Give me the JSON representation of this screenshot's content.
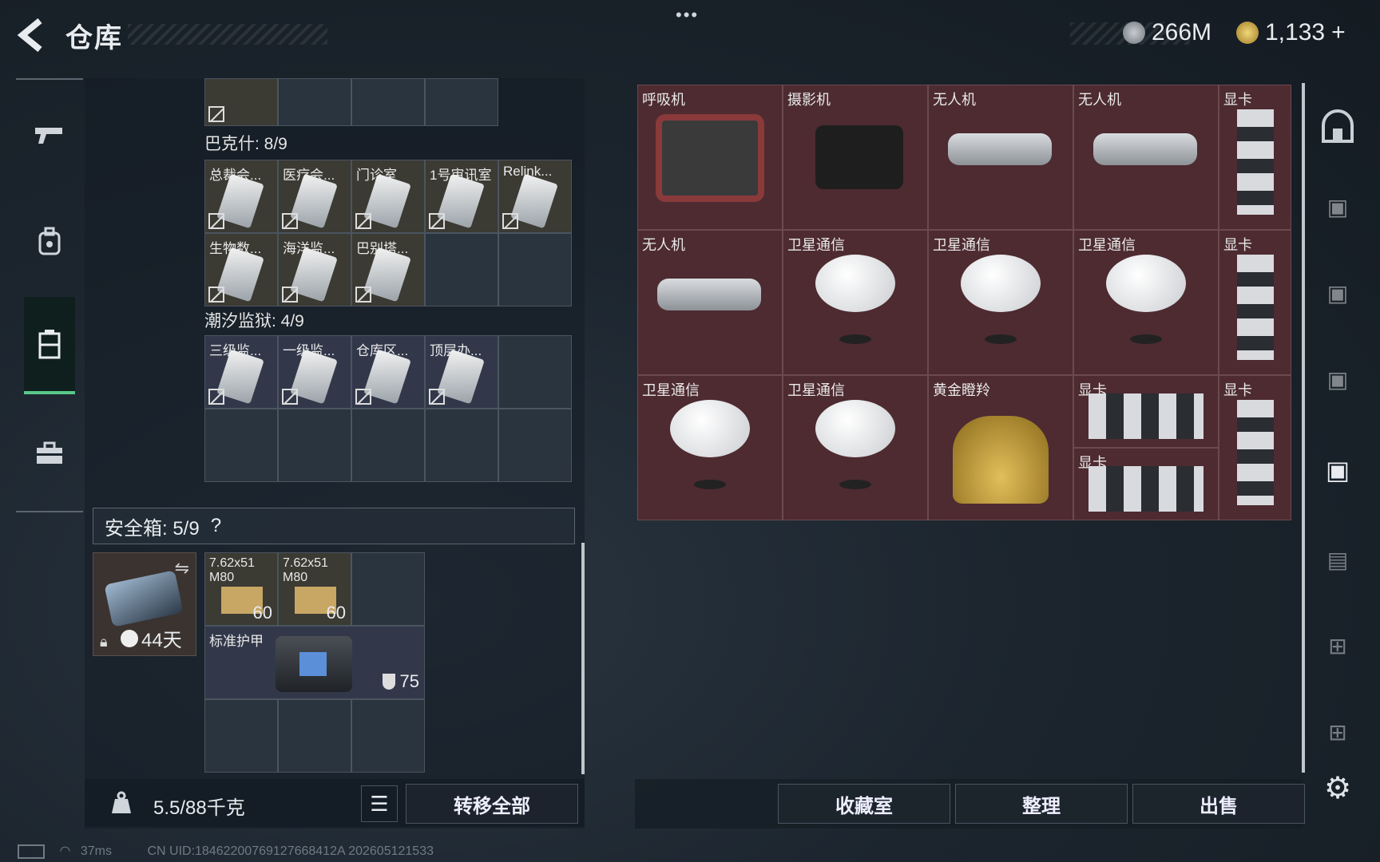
{
  "header": {
    "title": "仓库",
    "dots": "•••",
    "currency_silver": "266M",
    "currency_gold": "1,133",
    "plus": "+"
  },
  "left_nav": [
    "weapon-icon",
    "backpack-icon",
    "storage-icon",
    "toolbox-icon"
  ],
  "keys": {
    "bakshi_title": "巴克什: 8/9",
    "bakshi_items": [
      "总裁会...",
      "医疗会...",
      "门诊室",
      "1号审讯室",
      "Relink...",
      "生物数...",
      "海洋监...",
      "巴别塔..."
    ],
    "tide_title": "潮汐监狱: 4/9",
    "tide_items": [
      "三级监...",
      "一级监...",
      "仓库区...",
      "顶层办..."
    ]
  },
  "safe_box": {
    "title": "安全箱: 5/9",
    "help": "?",
    "days": "44天",
    "ammo1_label": "7.62x51 M80",
    "ammo1_count": "60",
    "ammo2_label": "7.62x51 M80",
    "ammo2_count": "60",
    "armor_label": "标准护甲",
    "armor_value": "75"
  },
  "bottom": {
    "weight": "5.5/88千克",
    "transfer_all": "转移全部",
    "collection": "收藏室",
    "organize": "整理",
    "sell": "出售"
  },
  "storage_items": [
    {
      "label": "呼吸机"
    },
    {
      "label": "摄影机"
    },
    {
      "label": "无人机"
    },
    {
      "label": "无人机"
    },
    {
      "label": "显卡"
    },
    {
      "label": "无人机"
    },
    {
      "label": "卫星通信"
    },
    {
      "label": "卫星通信"
    },
    {
      "label": "卫星通信"
    },
    {
      "label": "显卡"
    },
    {
      "label": "卫星通信"
    },
    {
      "label": "卫星通信"
    },
    {
      "label": "黄金瞪羚"
    },
    {
      "label": "显卡"
    },
    {
      "label": "显卡"
    },
    {
      "label": "显卡"
    }
  ],
  "status_bar": {
    "ping": "37ms",
    "uid": "CN UID:18462200769127668412A 202605121533"
  },
  "colors": {
    "active_green": "#59c98a",
    "item_red": "#4d2b31"
  }
}
